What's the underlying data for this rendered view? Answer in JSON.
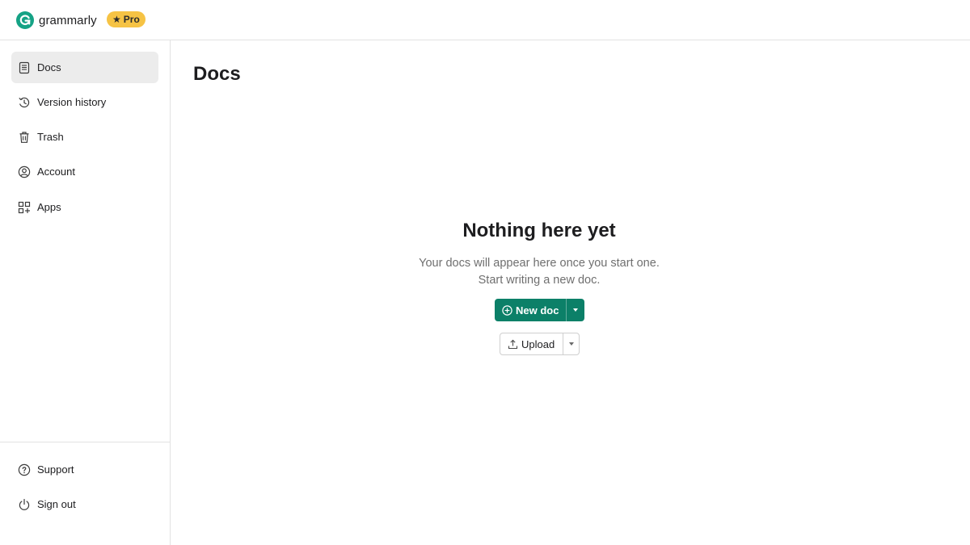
{
  "header": {
    "brand": "grammarly",
    "badge": {
      "icon": "star-icon",
      "label": "Pro"
    },
    "colors": {
      "brand_green": "#15a285",
      "badge_yellow": "#f6c344"
    }
  },
  "sidebar": {
    "items": [
      {
        "label": "Docs",
        "icon": "document-icon",
        "active": true
      },
      {
        "label": "Version history",
        "icon": "history-icon",
        "active": false
      },
      {
        "label": "Trash",
        "icon": "trash-icon",
        "active": false
      },
      {
        "label": "Account",
        "icon": "user-circle-icon",
        "active": false
      },
      {
        "label": "Apps",
        "icon": "apps-grid-icon",
        "active": false
      }
    ],
    "footer_items": [
      {
        "label": "Support",
        "icon": "help-icon"
      },
      {
        "label": "Sign out",
        "icon": "power-icon"
      }
    ]
  },
  "main": {
    "title": "Docs",
    "empty_state": {
      "title": "Nothing here yet",
      "line1": "Your docs will appear here once you start one.",
      "line2": "Start writing a new doc."
    },
    "new_doc_button": {
      "label": "New doc",
      "icon": "plus-circle-icon",
      "color": "#0c8068"
    },
    "upload_button": {
      "label": "Upload",
      "icon": "upload-icon"
    }
  }
}
